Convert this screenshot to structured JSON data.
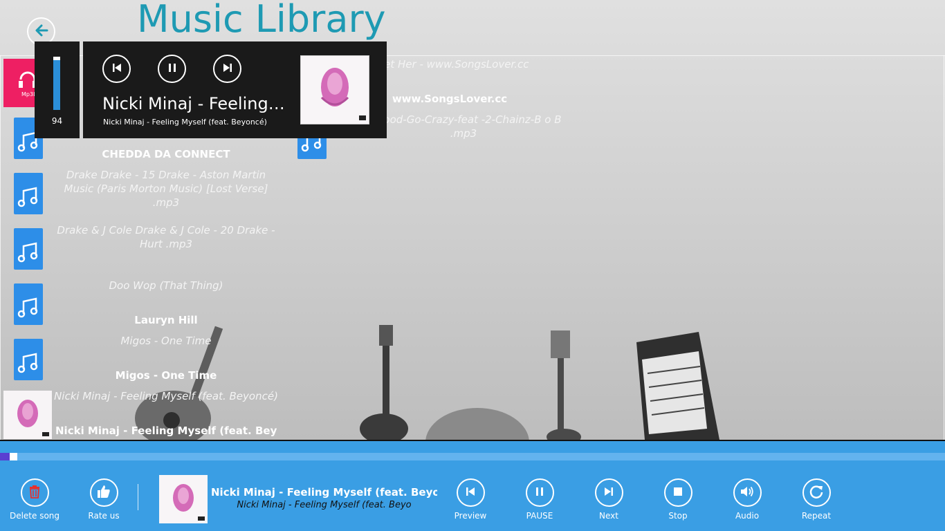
{
  "header": {
    "title": "Music Library",
    "back_icon": "back-arrow-icon"
  },
  "list_left": [
    {
      "text": "CHEDDA DA CONNECT",
      "kind": "heading"
    },
    {
      "text": "Drake   Drake - 15 Drake - Aston Martin Music (Paris Morton Music) [Lost Verse]  .mp3",
      "kind": "file"
    },
    {
      "text": "Drake & J  Cole   Drake & J  Cole - 20 Drake - Hurt  .mp3",
      "kind": "file"
    },
    {
      "text": "Doo Wop (That Thing)",
      "kind": "file"
    },
    {
      "text": "Lauryn Hill",
      "kind": "heading"
    },
    {
      "text": "Migos - One Time",
      "kind": "file"
    },
    {
      "text": "Migos - One Time",
      "kind": "heading"
    },
    {
      "text": "Nicki Minaj - Feeling Myself (feat. Beyoncé)",
      "kind": "file"
    },
    {
      "text": "Nicki Minaj - Feeling Myself (feat. Beyo",
      "kind": "heading"
    }
  ],
  "list_right": [
    {
      "text": "ne Get Her - www.SongsLover.cc",
      "kind": "file"
    },
    {
      "text": "www.SongsLover.cc",
      "kind": "heading"
    },
    {
      "text": "e-Hood-Go-Crazy-feat -2-Chainz-B o B  .mp3",
      "kind": "file"
    }
  ],
  "mp3_thumb_label": "Mp3Lio .cc",
  "overlay": {
    "volume": 94,
    "volume_fraction": 0.94,
    "title": "Nicki Minaj - Feeling…",
    "subtitle": "Nicki Minaj - Feeling Myself (feat. Beyoncé)",
    "buttons": [
      "previous-icon",
      "pause-icon",
      "next-icon"
    ]
  },
  "playback": {
    "progress_fraction": 0.01
  },
  "bottom_bar": {
    "delete_label": "Delete song",
    "rate_label": "Rate us",
    "now_title": "Nicki Minaj - Feeling Myself (feat. Beyoncé)",
    "now_subtitle": "Nicki Minaj - Feeling Myself (feat. Beyo",
    "preview_label": "Preview",
    "pause_label": "PAUSE",
    "next_label": "Next",
    "stop_label": "Stop",
    "audio_label": "Audio",
    "repeat_label": "Repeat"
  },
  "colors": {
    "accent": "#3a9ee4",
    "title": "#1e9ab3",
    "file_icon": "#2d8ee8",
    "overlay_bg": "#1a1a1a"
  }
}
